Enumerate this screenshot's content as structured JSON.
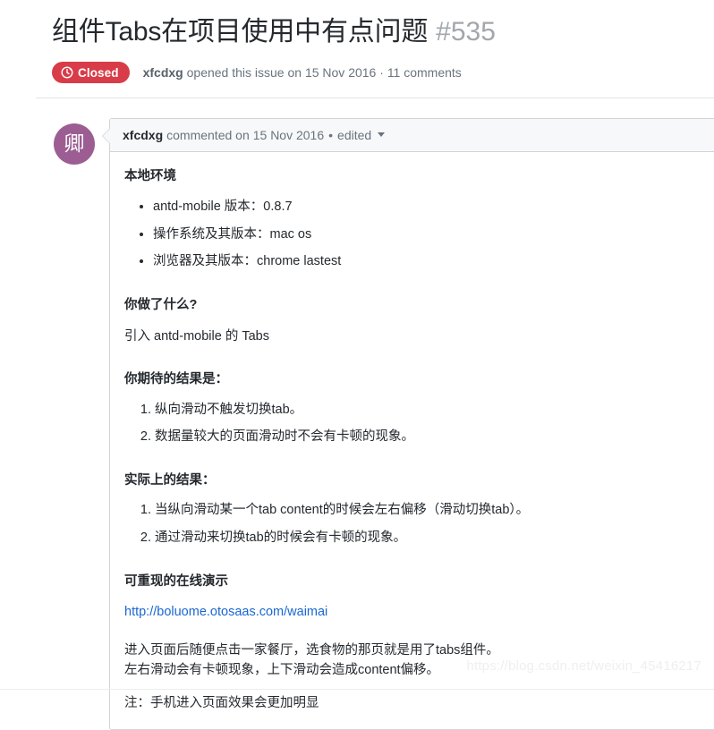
{
  "issue": {
    "title": "组件Tabs在项目使用中有点问题",
    "number": "#535",
    "state_label": "Closed",
    "state_icon": "issue-closed-icon",
    "state_color": "#d83c48",
    "meta_author": "xfcdxg",
    "meta_action": "opened this issue on",
    "meta_date": "15 Nov 2016",
    "meta_separator": "·",
    "meta_comments": "11 comments"
  },
  "comment": {
    "avatar_char": "卿",
    "avatar_color": "#9c5d93",
    "author": "xfcdxg",
    "action": "commented on",
    "date": "15 Nov 2016",
    "separator": "•",
    "edited_label": "edited",
    "sections": {
      "env_heading": "本地环境",
      "env_items": [
        "antd-mobile 版本：0.8.7",
        "操作系统及其版本：mac os",
        "浏览器及其版本：chrome lastest"
      ],
      "did_heading": "你做了什么?",
      "did_text": "引入 antd-mobile 的 Tabs",
      "expected_heading": "你期待的结果是：",
      "expected_items": [
        "纵向滑动不触发切换tab。",
        "数据量较大的页面滑动时不会有卡顿的现象。"
      ],
      "actual_heading": "实际上的结果：",
      "actual_items": [
        "当纵向滑动某一个tab content的时候会左右偏移（滑动切换tab）。",
        "通过滑动来切换tab的时候会有卡顿的现象。"
      ],
      "demo_heading": "可重现的在线演示",
      "demo_link": "http://boluome.otosaas.com/waimai",
      "demo_desc_line1": "进入页面后随便点击一家餐厅，选食物的那页就是用了tabs组件。",
      "demo_desc_line2": "左右滑动会有卡顿现象，上下滑动会造成content偏移。",
      "note_text": "注：手机进入页面效果会更加明显"
    }
  },
  "watermark": "https://blog.csdn.net/weixin_45416217",
  "colors": {
    "link": "#1967d2",
    "state_closed": "#d83c48",
    "muted": "#6a737d",
    "border": "#d1d5da",
    "header_bg": "#f6f8fa"
  }
}
